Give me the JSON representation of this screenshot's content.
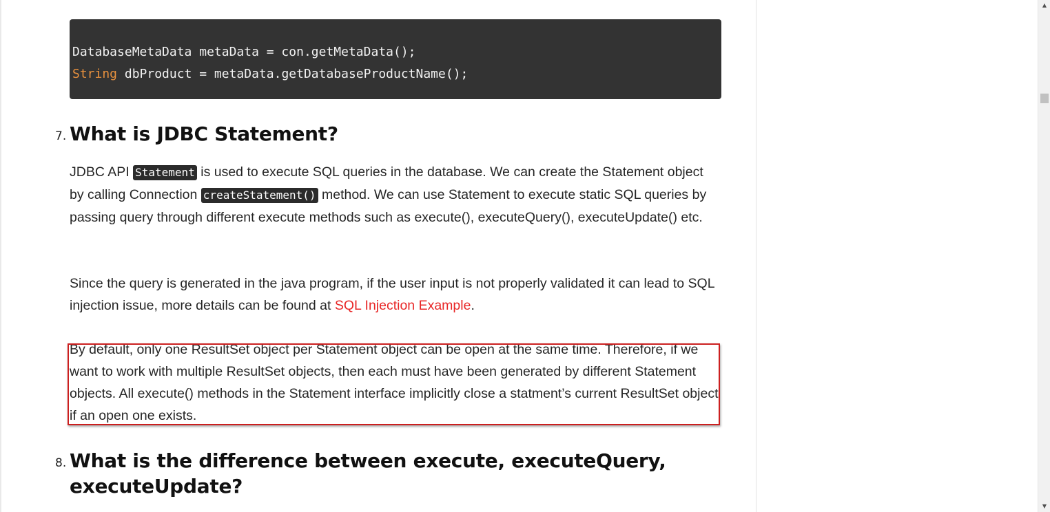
{
  "code": {
    "line1": "DatabaseMetaData metaData = con.getMetaData();",
    "line2_type": "String",
    "line2_rest": " dbProduct = metaData.getDatabaseProductName();"
  },
  "section7": {
    "number": "7.",
    "title": "What is JDBC Statement?",
    "p1": {
      "t1": "JDBC API ",
      "code1": "Statement",
      "t2": " is used to execute SQL queries in the database. We can create the Statement object by calling Connection ",
      "code2": "createStatement()",
      "t3": " method. We can use Statement to execute static SQL queries by passing query through different execute methods such as execute(), executeQuery(), executeUpdate() etc."
    },
    "p2": {
      "t1": "Since the query is generated in the java program, if the user input is not properly validated it can lead to SQL injection issue, more details can be found at ",
      "link": "SQL Injection Example",
      "t2": "."
    },
    "p3": "By default, only one ResultSet object per Statement object can be open at the same time. Therefore, if we want to work with multiple ResultSet objects, then each must have been generated by different Statement objects. All execute() methods in the Statement interface implicitly close a statment’s current ResultSet object if an open one exists."
  },
  "section8": {
    "number": "8.",
    "title_line1": "What is the difference between execute, executeQuery,",
    "title_line2": "executeUpdate?"
  },
  "colors": {
    "code_bg": "#333333",
    "code_keyword": "#e8913e",
    "link": "#e82626",
    "highlight_border": "#cc1f1f"
  },
  "scrollbar": {
    "up_icon": "triangle-up-icon",
    "down_icon": "triangle-down-icon"
  }
}
